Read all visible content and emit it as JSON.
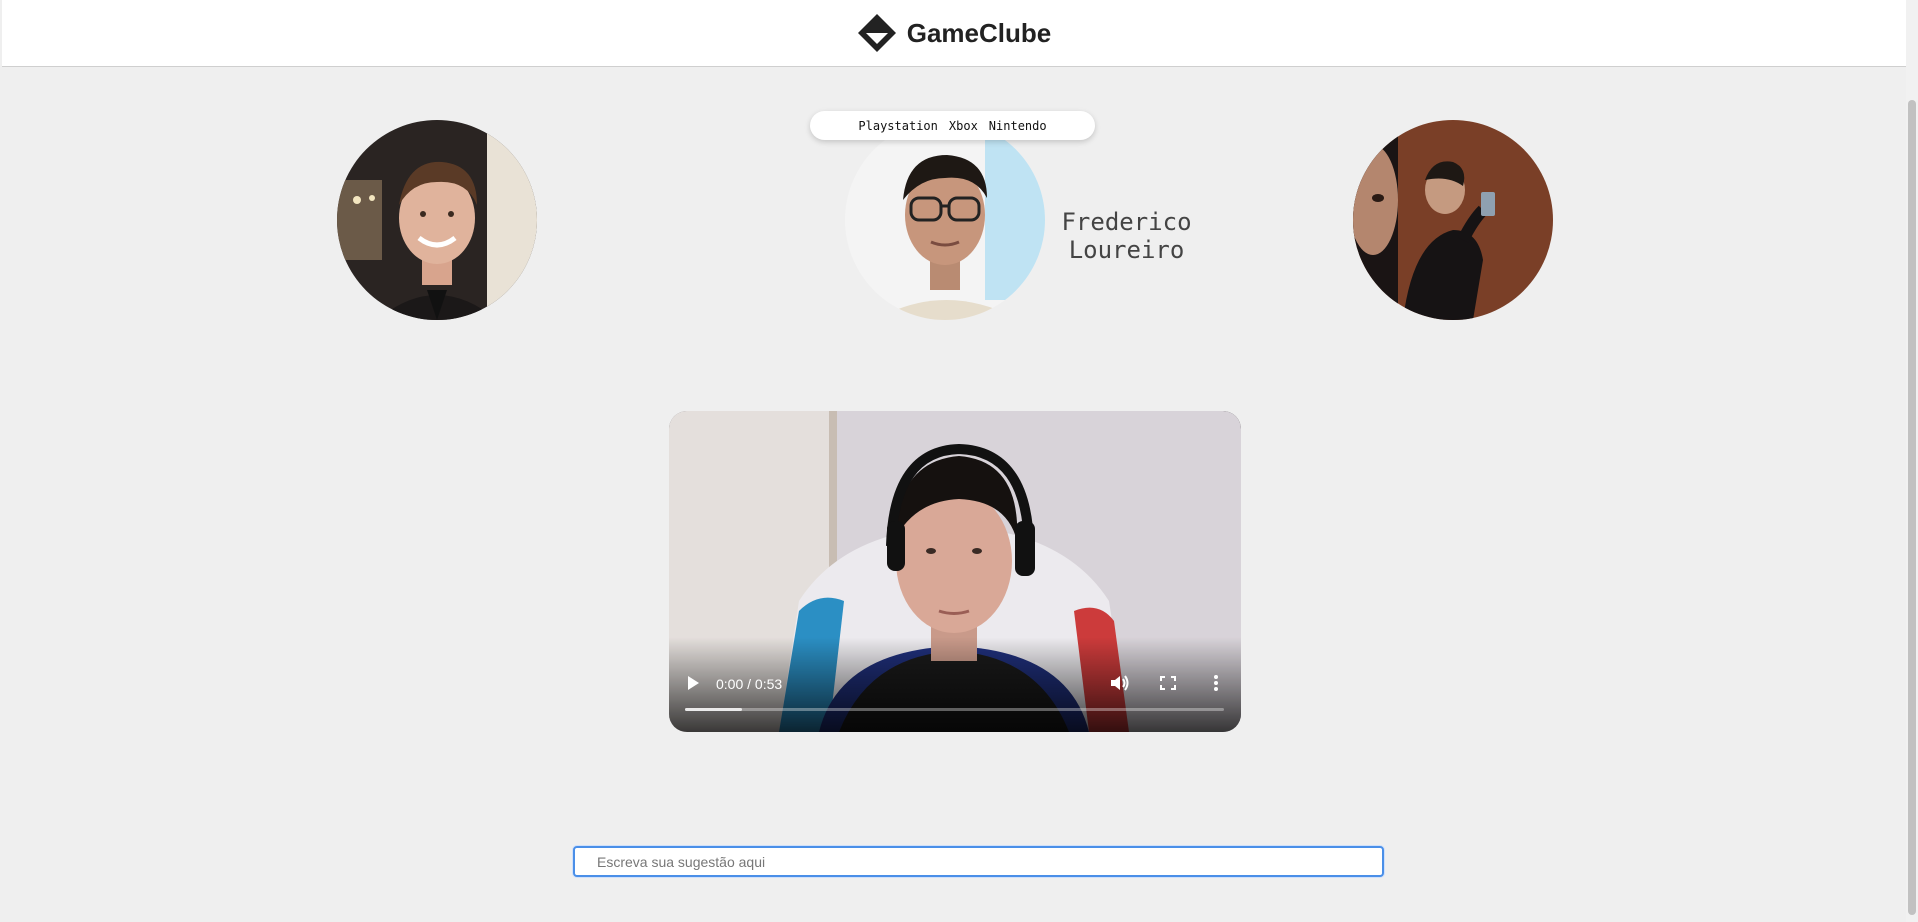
{
  "header": {
    "brand": "GameClube"
  },
  "nav": {
    "items": [
      "Playstation",
      "Xbox",
      "Nintendo"
    ]
  },
  "featured_member": {
    "name_line1": "Frederico",
    "name_line2": "Loureiro"
  },
  "video": {
    "time": "0:00 / 0:53",
    "buffered_fraction": 0.105
  },
  "suggestion": {
    "placeholder": "Escreva sua sugestão aqui"
  }
}
